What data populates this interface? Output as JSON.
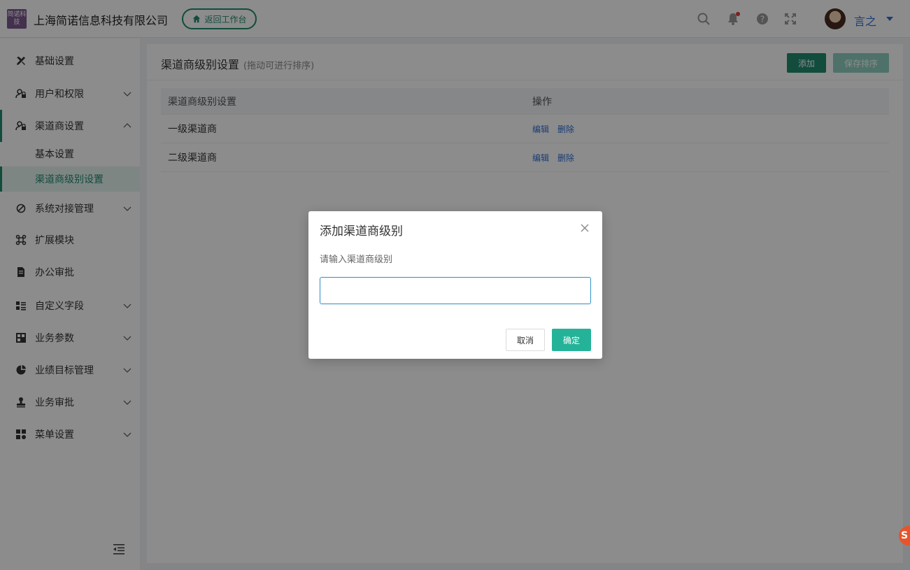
{
  "header": {
    "logo_text": "简诺科技",
    "company": "上海简诺信息科技有限公司",
    "back_label": "返回工作台",
    "username": "言之"
  },
  "sidebar": {
    "items": [
      {
        "label": "基础设置",
        "icon": "tools-icon",
        "chevron": false
      },
      {
        "label": "用户和权限",
        "icon": "user-lock-icon",
        "chevron": true
      },
      {
        "label": "渠道商设置",
        "icon": "user-lock-icon",
        "chevron": true,
        "open": true
      },
      {
        "label": "系统对接管理",
        "icon": "link-icon",
        "chevron": true
      },
      {
        "label": "扩展模块",
        "icon": "command-icon",
        "chevron": false
      },
      {
        "label": "办公审批",
        "icon": "document-icon",
        "chevron": false
      },
      {
        "label": "自定义字段",
        "icon": "list-icon",
        "chevron": true
      },
      {
        "label": "业务参数",
        "icon": "grid-icon",
        "chevron": true
      },
      {
        "label": "业绩目标管理",
        "icon": "target-icon",
        "chevron": true
      },
      {
        "label": "业务审批",
        "icon": "stamp-icon",
        "chevron": true
      },
      {
        "label": "菜单设置",
        "icon": "apps-icon",
        "chevron": true
      }
    ],
    "sub_items": [
      {
        "label": "基本设置"
      },
      {
        "label": "渠道商级别设置",
        "active": true
      }
    ]
  },
  "main": {
    "title": "渠道商级别设置",
    "hint": "(拖动可进行排序)",
    "add_label": "添加",
    "save_label": "保存排序",
    "columns": [
      "渠道商级别设置",
      "操作"
    ],
    "rows": [
      {
        "name": "一级渠道商",
        "edit": "编辑",
        "delete": "删除"
      },
      {
        "name": "二级渠道商",
        "edit": "编辑",
        "delete": "删除"
      }
    ]
  },
  "modal": {
    "title": "添加渠道商级别",
    "label": "请输入渠道商级别",
    "input_value": "",
    "cancel_label": "取消",
    "ok_label": "确定"
  },
  "colors": {
    "brand": "#1f8a70",
    "primary_button": "#24b398",
    "link": "#2f6fd6"
  }
}
